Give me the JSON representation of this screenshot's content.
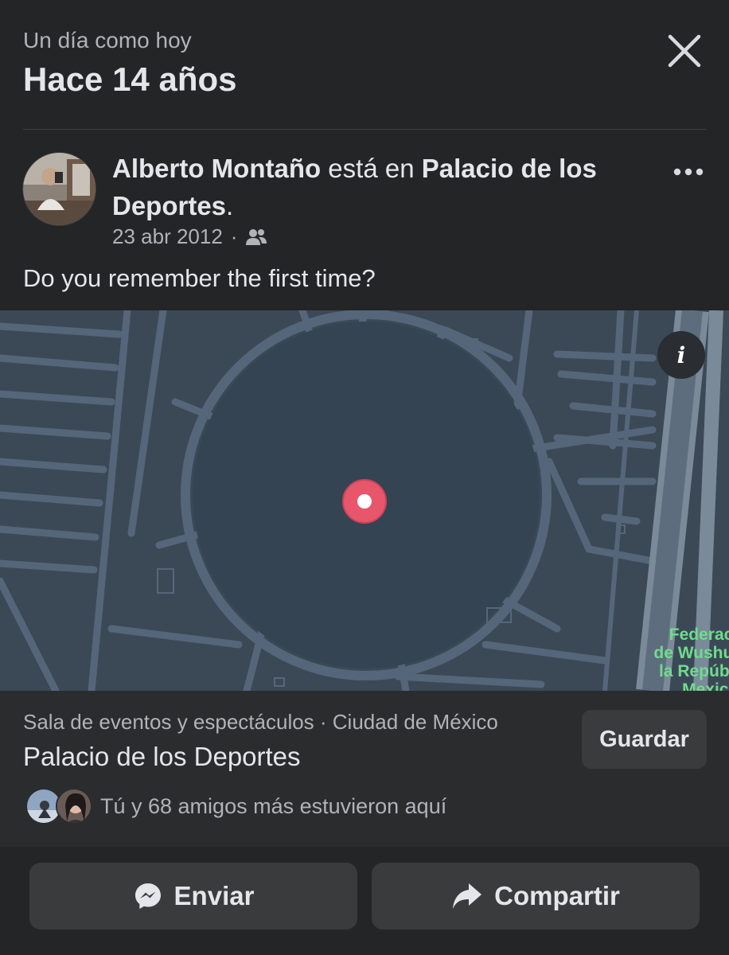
{
  "header": {
    "subtitle": "Un día como hoy",
    "title": "Hace 14 años",
    "close_icon": "close-icon"
  },
  "post": {
    "author": "Alberto Montaño",
    "connector": " está en ",
    "place": "Palacio de los Deportes",
    "period": ".",
    "date": "23 abr 2012",
    "separator": "·",
    "audience_icon": "friends-icon",
    "text": "Do you remember the first time?"
  },
  "map": {
    "info_label": "i",
    "label_lines": [
      "Federació",
      "de Wushu d",
      "la Repúblic",
      "Mexican"
    ],
    "pin_color": "#e8566b",
    "background_color": "#3b4956"
  },
  "place_card": {
    "category": "Sala de eventos y espectáculos · Ciudad de México",
    "name": "Palacio de los Deportes",
    "save_label": "Guardar",
    "friends_text": "Tú y 68 amigos más estuvieron aquí"
  },
  "footer": {
    "send_label": "Enviar",
    "send_icon": "messenger-icon",
    "share_label": "Compartir",
    "share_icon": "share-arrow-icon"
  }
}
